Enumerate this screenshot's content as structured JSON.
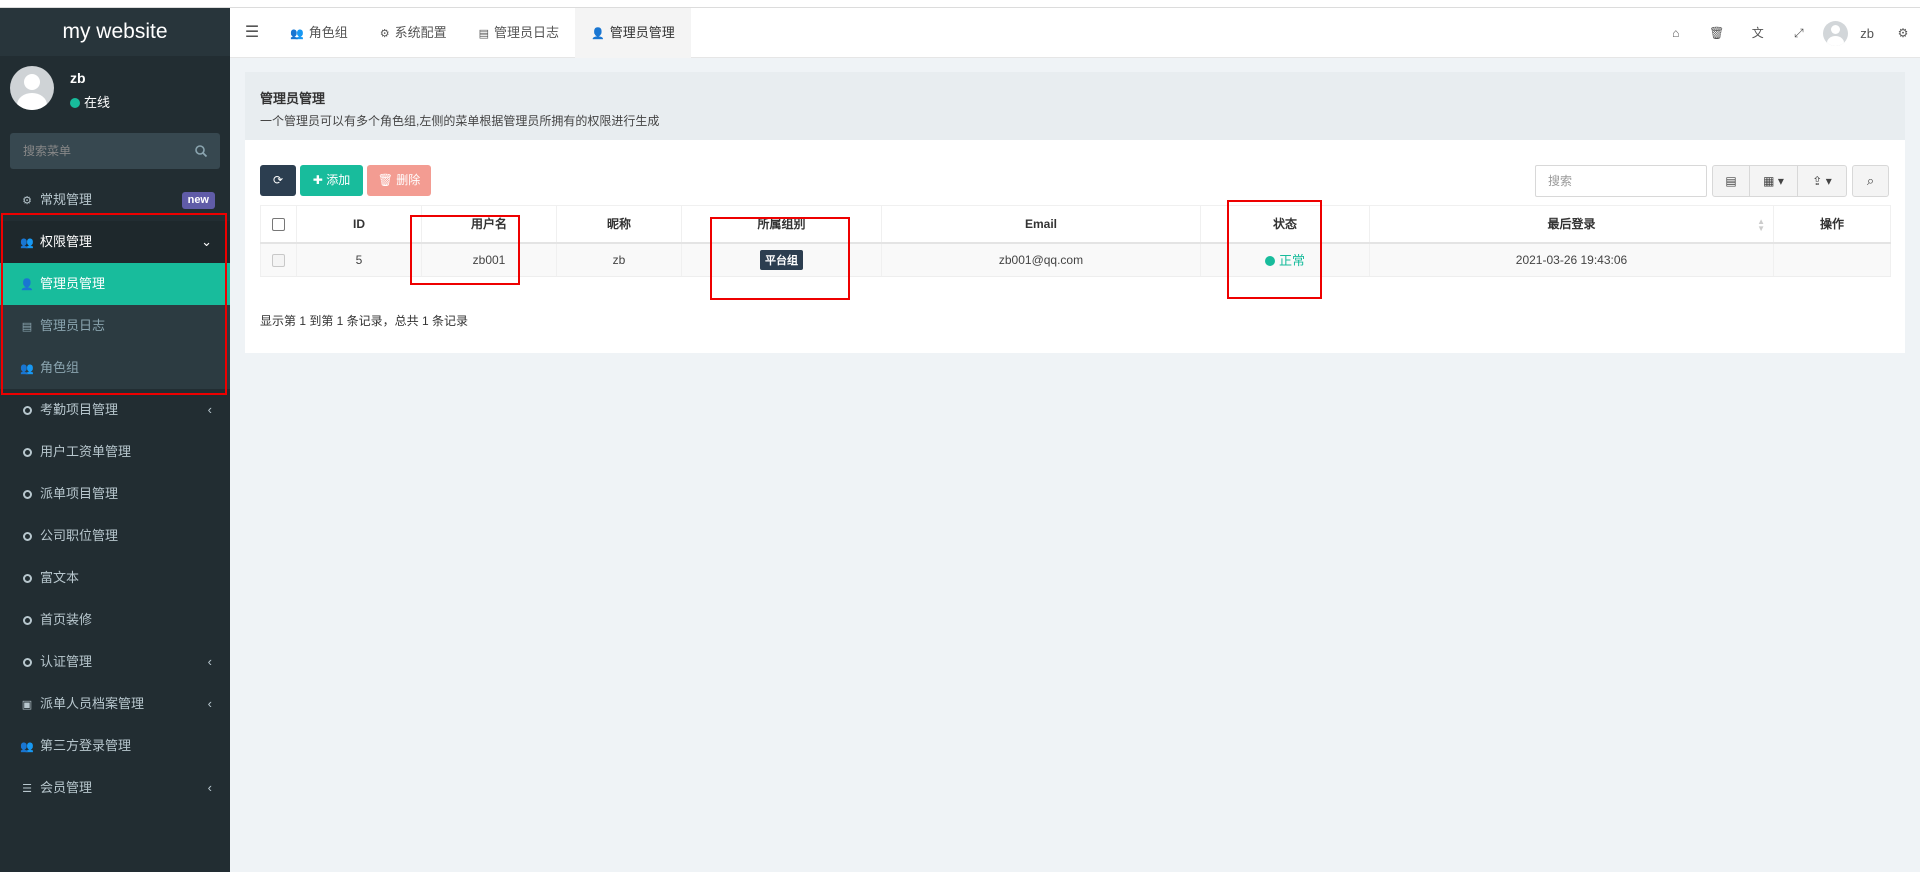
{
  "app": {
    "name": "my website"
  },
  "user": {
    "name": "zb",
    "status": "在线"
  },
  "sidebar": {
    "search_placeholder": "搜索菜单",
    "items": [
      {
        "label": "常规管理",
        "icon": "cogs-icon",
        "badge": "new"
      },
      {
        "label": "权限管理",
        "icon": "users-icon"
      },
      {
        "label": "考勤项目管理",
        "icon": "circle-icon"
      },
      {
        "label": "用户工资单管理",
        "icon": "circle-icon"
      },
      {
        "label": "派单项目管理",
        "icon": "circle-icon"
      },
      {
        "label": "公司职位管理",
        "icon": "circle-icon"
      },
      {
        "label": "富文本",
        "icon": "circle-icon"
      },
      {
        "label": "首页装修",
        "icon": "circle-icon"
      },
      {
        "label": "认证管理",
        "icon": "circle-icon"
      },
      {
        "label": "派单人员档案管理",
        "icon": "address-card-icon"
      },
      {
        "label": "第三方登录管理",
        "icon": "users-icon"
      },
      {
        "label": "会员管理",
        "icon": "list-icon"
      }
    ],
    "submenu": [
      {
        "label": "管理员管理",
        "icon": "user-icon",
        "active": true
      },
      {
        "label": "管理员日志",
        "icon": "list-alt-icon"
      },
      {
        "label": "角色组",
        "icon": "group-icon"
      }
    ]
  },
  "header": {
    "tabs": [
      {
        "label": "角色组",
        "icon": "group-icon"
      },
      {
        "label": "系统配置",
        "icon": "gear-icon"
      },
      {
        "label": "管理员日志",
        "icon": "list-alt-icon"
      },
      {
        "label": "管理员管理",
        "icon": "user-icon",
        "active": true
      }
    ],
    "right_icons": [
      "home-icon",
      "trash-icon",
      "language-icon",
      "fullscreen-icon"
    ],
    "user_name": "zb"
  },
  "page": {
    "title": "管理员管理",
    "description": "一个管理员可以有多个角色组,左侧的菜单根据管理员所拥有的权限进行生成"
  },
  "toolbar": {
    "add_label": "添加",
    "delete_label": "删除",
    "search_placeholder": "搜索"
  },
  "table": {
    "columns": [
      "ID",
      "用户名",
      "昵称",
      "所属组别",
      "Email",
      "状态",
      "最后登录",
      "操作"
    ],
    "rows": [
      {
        "id": "5",
        "username": "zb001",
        "nickname": "zb",
        "group": "平台组",
        "email": "zb001@qq.com",
        "status": "正常",
        "last_login": "2021-03-26 19:43:06",
        "actions": ""
      }
    ]
  },
  "pagination": {
    "info": "显示第 1 到第 1 条记录，总共 1 条记录"
  },
  "colors": {
    "accent": "#18bc9c",
    "sidebar_bg": "#222d32",
    "danger": "#f39c92",
    "dark": "#2c3e50",
    "annotation": "#e00000"
  }
}
